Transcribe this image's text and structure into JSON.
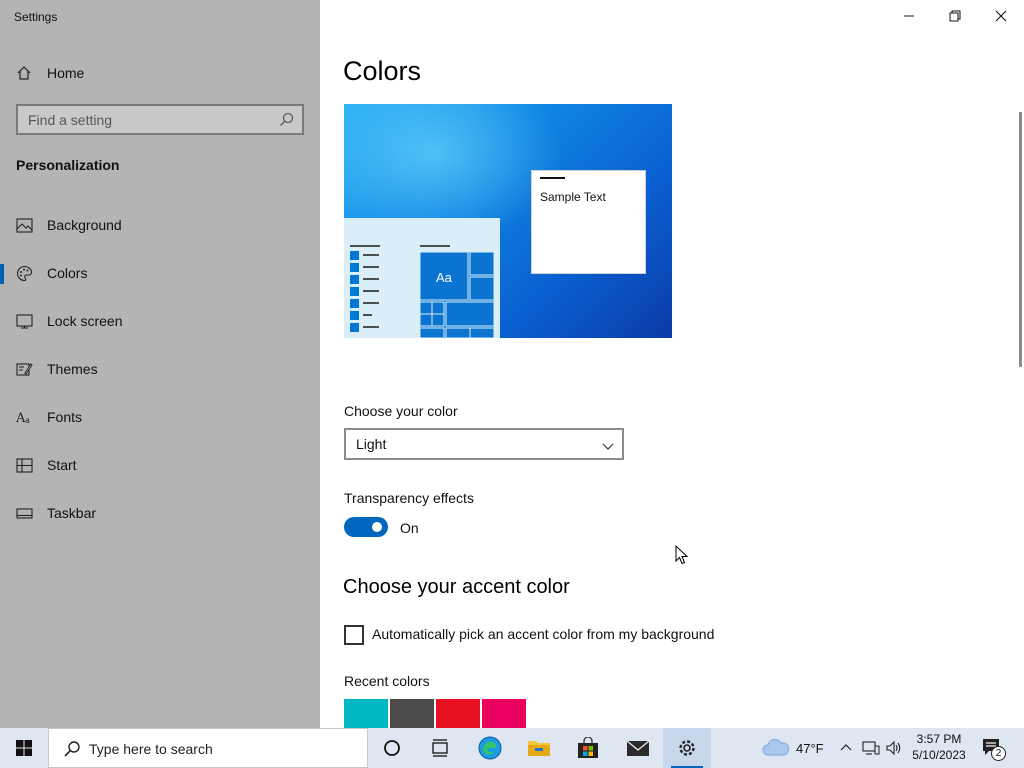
{
  "window": {
    "title": "Settings"
  },
  "sidebar": {
    "home_label": "Home",
    "search_placeholder": "Find a setting",
    "section": "Personalization",
    "items": [
      {
        "label": "Background",
        "icon": "picture-icon"
      },
      {
        "label": "Colors",
        "icon": "palette-icon",
        "active": true
      },
      {
        "label": "Lock screen",
        "icon": "lock-screen-icon"
      },
      {
        "label": "Themes",
        "icon": "themes-icon"
      },
      {
        "label": "Fonts",
        "icon": "fonts-icon"
      },
      {
        "label": "Start",
        "icon": "start-icon"
      },
      {
        "label": "Taskbar",
        "icon": "taskbar-icon"
      }
    ]
  },
  "main": {
    "title": "Colors",
    "preview": {
      "sample_text": "Sample Text",
      "tile_text": "Aa"
    },
    "choose_color": {
      "label": "Choose your color",
      "value": "Light"
    },
    "transparency": {
      "label": "Transparency effects",
      "state": "On"
    },
    "accent": {
      "heading": "Choose your accent color",
      "auto_pick_label": "Automatically pick an accent color from my background",
      "auto_pick_checked": false,
      "recent_label": "Recent colors",
      "recent_colors": [
        "#00b7c3",
        "#4c4a48",
        "#e81123",
        "#ea005e"
      ]
    }
  },
  "taskbar": {
    "search_placeholder": "Type here to search",
    "weather": "47°F",
    "time": "3:57 PM",
    "date": "5/10/2023",
    "notification_count": "2"
  },
  "colors": {
    "accent": "#0067c0",
    "sidebar_bg": "#b4b4b4",
    "taskbar_bg": "#dde6f1"
  }
}
